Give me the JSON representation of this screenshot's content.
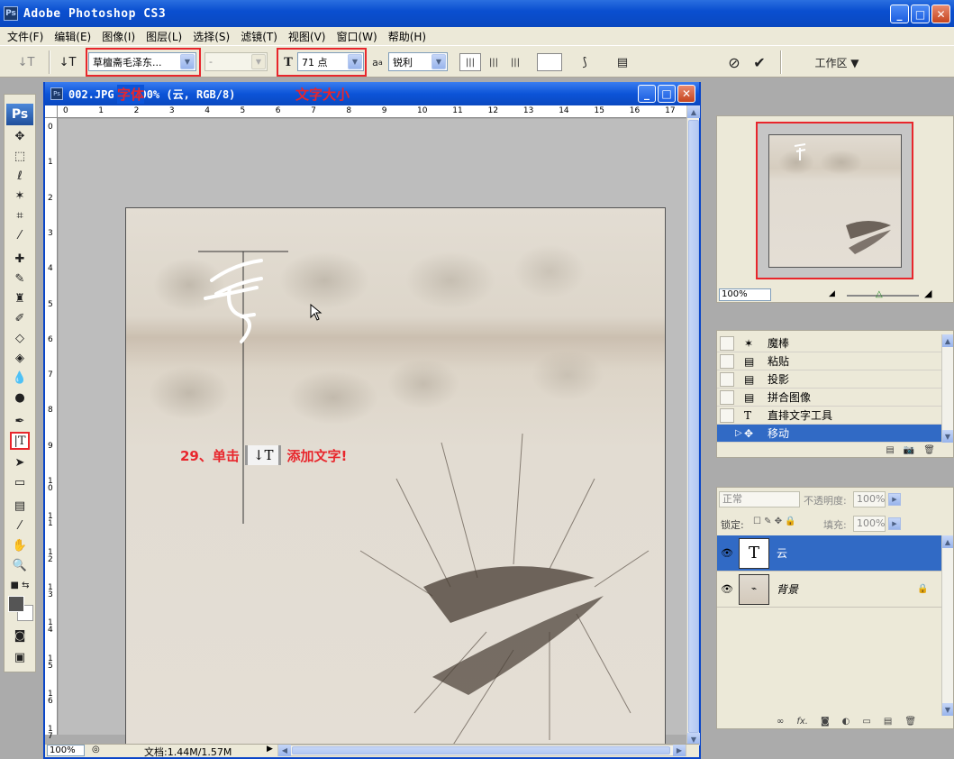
{
  "window": {
    "title": "Adobe Photoshop CS3",
    "app_badge": "Ps",
    "min": "_",
    "max": "□",
    "close": "✕"
  },
  "menu": [
    "文件(F)",
    "编辑(E)",
    "图像(I)",
    "图层(L)",
    "选择(S)",
    "滤镜(T)",
    "视图(V)",
    "窗口(W)",
    "帮助(H)"
  ],
  "options": {
    "tool_glyph": "↓T",
    "font_family": "草檀斋毛泽东...",
    "font_style": "-",
    "font_size": "71 点",
    "aa_label": "a",
    "antialias": "锐利",
    "workspace": "工作区 ▼"
  },
  "document": {
    "badge": "Ps",
    "title": "002.JPG @ 100% (云, RGB/8)",
    "annot_font": "字体",
    "annot_size": "文字大小",
    "step_text_before": "29、单击",
    "step_text_after": "添加文字!",
    "step_icon": "↓T",
    "zoom": "100%",
    "doc_info": "文档:1.44M/1.57M",
    "h_ruler": [
      "0",
      "1",
      "2",
      "3",
      "4",
      "5",
      "6",
      "7",
      "8",
      "9",
      "10",
      "11",
      "12",
      "13",
      "14",
      "15",
      "16",
      "17"
    ],
    "v_ruler": [
      "0",
      "1",
      "2",
      "3",
      "4",
      "5",
      "6",
      "7",
      "8",
      "9",
      "1 0",
      "1 1",
      "1 2",
      "1 3",
      "1 4",
      "1 5",
      "1 6",
      "1 7"
    ]
  },
  "navigator": {
    "zoom": "100%"
  },
  "history": [
    {
      "label": "魔棒",
      "icon": "magic-wand"
    },
    {
      "label": "粘贴",
      "icon": "history-step"
    },
    {
      "label": "投影",
      "icon": "history-step"
    },
    {
      "label": "拼合图像",
      "icon": "history-step"
    },
    {
      "label": "直排文字工具",
      "icon": "vertical-type"
    },
    {
      "label": "移动",
      "icon": "move",
      "selected": true
    }
  ],
  "layers": {
    "blend_mode": "正常",
    "opacity_label": "不透明度:",
    "opacity": "100%",
    "lock_label": "锁定:",
    "fill_label": "填充:",
    "fill": "100%",
    "items": [
      {
        "name": "云",
        "type": "text",
        "selected": true
      },
      {
        "name": "背景",
        "type": "image",
        "locked": true
      }
    ]
  },
  "colors": {
    "accent": "#316ac5",
    "annotation": "#e8262c",
    "titlebar": "#0a4fd0"
  }
}
